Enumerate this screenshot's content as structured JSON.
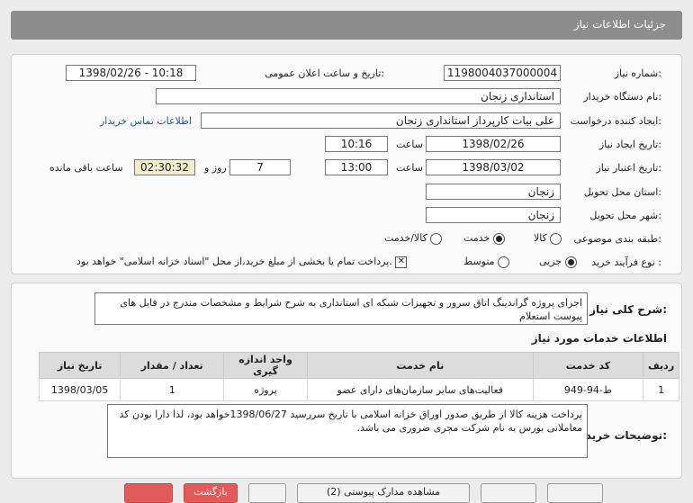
{
  "header": {
    "title": "جزئیات اطلاعات نیاز"
  },
  "form": {
    "need_number_label": "شماره نیاز:",
    "need_number": "1198004037000004",
    "announce_label": "تاریخ و ساعت اعلان عمومی:",
    "announce_value": "1398/02/26 - 10:18",
    "buyer_org_label": "نام دستگاه خریدار:",
    "buyer_org": "استانداری زنجان",
    "requester_label": "ایجاد کننده درخواست:",
    "requester": "علی بیات کارپرداز  استانداری زنجان",
    "contact_link": "اطلاعات تماس خریدار",
    "created_label": "تاریخ ایجاد نیاز:",
    "created_date": "1398/02/26",
    "hour_label": "ساعت",
    "created_time": "10:16",
    "validity_label": "تاریخ اعتبار نیاز:",
    "validity_date": "1398/03/02",
    "validity_time": "13:00",
    "days_value": "7",
    "days_label": "روز و",
    "remaining_time": "02:30:32",
    "remaining_label": "ساعت باقی مانده",
    "province_label": "استان محل تحویل:",
    "province": "زنجان",
    "city_label": "شهر محل تحویل:",
    "city": "زنجان",
    "category_label": "طبقه بندی موضوعی:",
    "category_options": [
      "کالا",
      "خدمت",
      "کالا/خدمت"
    ],
    "category_selected": "خدمت",
    "process_label": "نوع فرآیند خرید :",
    "process_options": [
      "جزیی",
      "متوسط"
    ],
    "process_selected": "جزیی",
    "payment_note": "پرداخت تمام یا بخشی از مبلغ خرید،از محل \"اسناد خزانه اسلامی\" خواهد بود."
  },
  "summary": {
    "label": "شرح کلی نیاز:",
    "text": "اجرای پروژه گراندینگ اتاق سرور و تجهیزات شبکه ای استانداری به شرح شرایط و مشخصات مندرج در فایل های پیوست استعلام"
  },
  "services": {
    "heading": "اطلاعات خدمات مورد نیاز",
    "columns": [
      "ردیف",
      "کد خدمت",
      "نام خدمت",
      "واحد اندازه گیری",
      "تعداد / مقدار",
      "تاریخ نیاز"
    ],
    "rows": [
      [
        "1",
        "ط-94-949",
        "فعالیت‌های سایر سازمان‌های دارای عضو",
        "پروژه",
        "1",
        "1398/03/05"
      ]
    ]
  },
  "buyer_notes": {
    "label": "توضیحات خریدار:",
    "text": "پرداخت هزینه کالا از طریق صدور اوراق خزانه اسلامی با تاریخ سررسید 1398/06/27خواهد بود، لذا دارا بودن کد معاملاتی بورس به نام شرکت مجری ضروری می باشد."
  },
  "footer": {
    "buttons": [
      "",
      "بازگشت",
      "",
      "مشاهده مدارک پیوستی (2)",
      "",
      ""
    ]
  }
}
